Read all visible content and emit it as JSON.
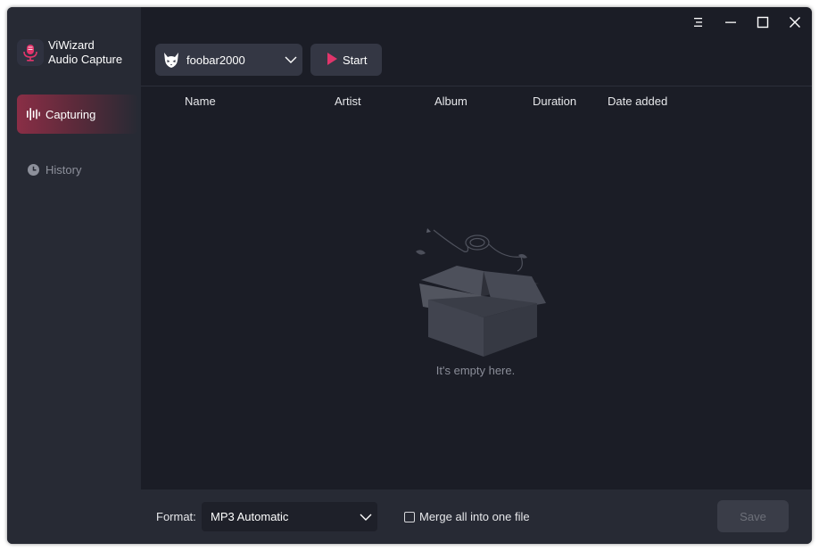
{
  "brand": {
    "name_line1": "ViWizard",
    "name_line2": "Audio Capture",
    "logo_icon": "microphone-icon"
  },
  "sidebar": {
    "items": [
      {
        "label": "Capturing",
        "icon": "audio-wave-icon",
        "active": true
      },
      {
        "label": "History",
        "icon": "clock-icon",
        "active": false
      }
    ]
  },
  "window_controls": {
    "menu_icon": "menu-icon",
    "minimize_icon": "minimize-icon",
    "maximize_icon": "maximize-icon",
    "close_icon": "close-icon"
  },
  "toolbar": {
    "source": {
      "selected": "foobar2000",
      "icon": "foobar2000-icon"
    },
    "start_label": "Start"
  },
  "table": {
    "columns": [
      "Name",
      "Artist",
      "Album",
      "Duration",
      "Date added"
    ]
  },
  "empty_state": {
    "message": "It's empty here.",
    "illustration": "empty-box"
  },
  "footer": {
    "format_label": "Format:",
    "format_value": "MP3 Automatic",
    "merge_label": "Merge all into one file",
    "merge_checked": false,
    "save_label": "Save"
  },
  "colors": {
    "accent": "#e0356b",
    "window_bg": "#1b1d26",
    "sidebar_bg": "#272a34",
    "active_nav": "#8a2e46"
  }
}
